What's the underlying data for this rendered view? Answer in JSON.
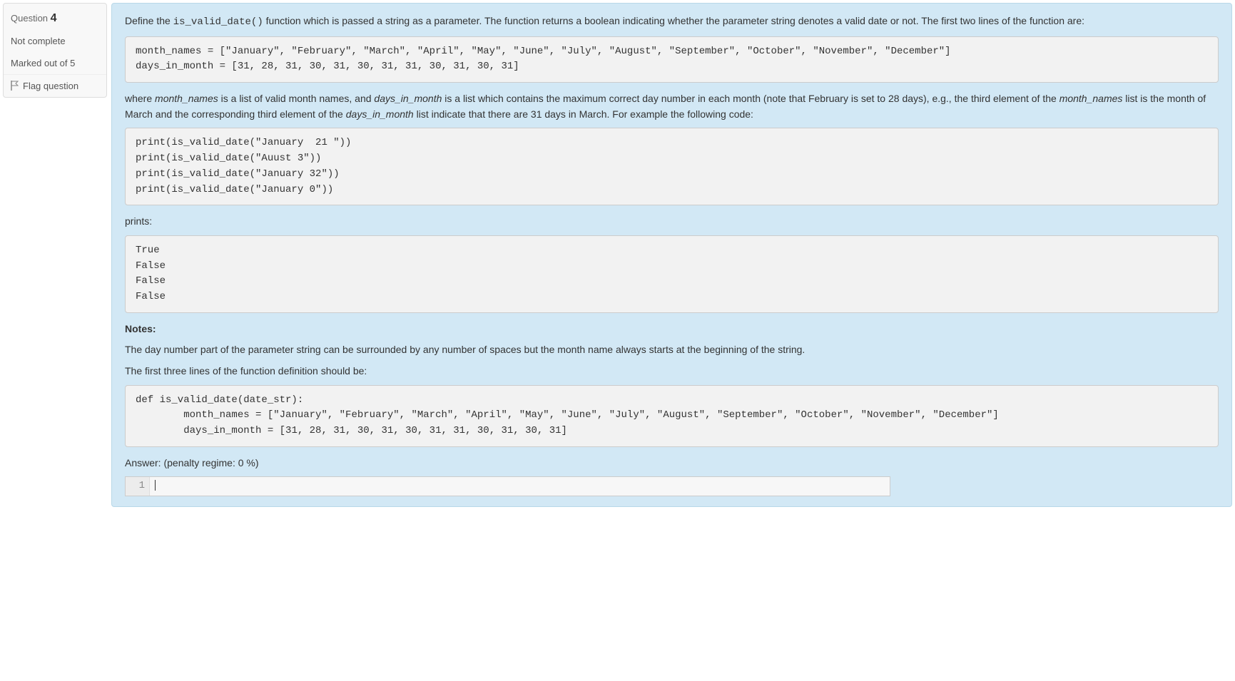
{
  "sidebar": {
    "question_label": "Question",
    "question_number": "4",
    "status": "Not complete",
    "marks": "Marked out of 5",
    "flag_label": "Flag question"
  },
  "content": {
    "intro_part1": "Define the ",
    "intro_code": "is_valid_date()",
    "intro_part2": " function which is passed a string as a parameter. The function returns a boolean indicating whether the parameter string denotes a valid date or not.  The first two lines of the function are:",
    "code1": "month_names = [\"January\", \"February\", \"March\", \"April\", \"May\", \"June\", \"July\", \"August\", \"September\", \"October\", \"November\", \"December\"]\ndays_in_month = [31, 28, 31, 30, 31, 30, 31, 31, 30, 31, 30, 31]",
    "para2_a": "where ",
    "para2_var1": "month_names",
    "para2_b": " is a list of valid month names, and ",
    "para2_var2": "days_in_month",
    "para2_c": " is a list which contains the maximum correct day number in each month (note that February is set to 28 days), e.g., the third element of the ",
    "para2_var3": "month_names",
    "para2_d": " list is the month of March and the corresponding third element of the ",
    "para2_var4": "days_in_month",
    "para2_e": " list indicate that there are 31 days in March.  For example the following code:",
    "code2": "print(is_valid_date(\"January  21 \"))\nprint(is_valid_date(\"Auust 3\"))\nprint(is_valid_date(\"January 32\"))\nprint(is_valid_date(\"January 0\"))",
    "prints_label": "prints:",
    "code3": "True\nFalse\nFalse\nFalse",
    "notes_head": "Notes:",
    "note1": "The day number part of the parameter string can be surrounded by any number of spaces but the month name always starts at the beginning of the string.",
    "note2": "The first three lines of the function definition should be:",
    "code4": "def is_valid_date(date_str):\n        month_names = [\"January\", \"February\", \"March\", \"April\", \"May\", \"June\", \"July\", \"August\", \"September\", \"October\", \"November\", \"December\"]\n        days_in_month = [31, 28, 31, 30, 31, 30, 31, 31, 30, 31, 30, 31]",
    "answer_label": "Answer:  (penalty regime: 0 %)",
    "editor_line_number": "1"
  }
}
